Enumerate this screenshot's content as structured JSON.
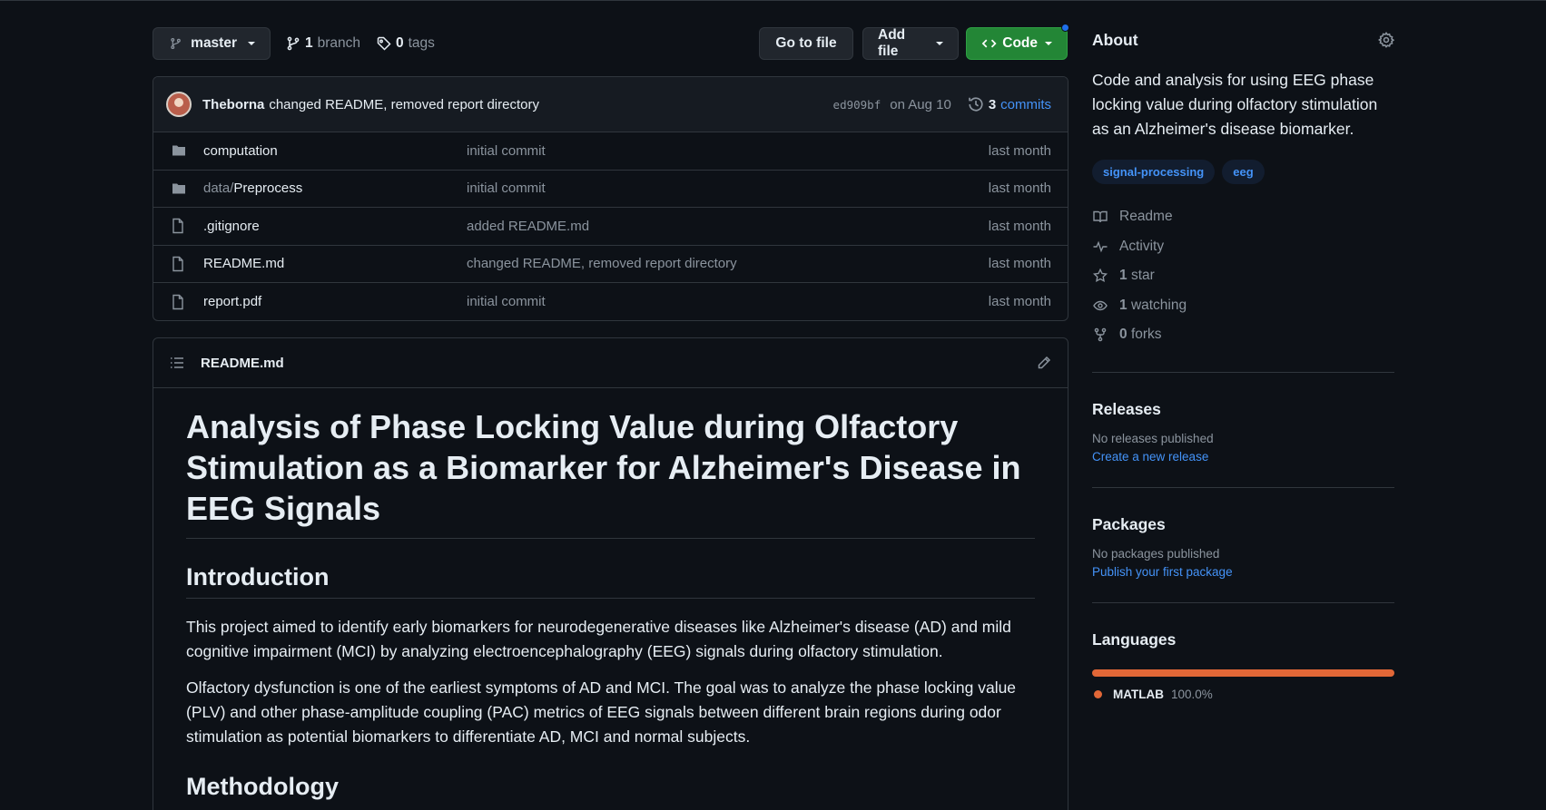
{
  "toolbar": {
    "branch_label": "master",
    "branch_count": "1",
    "branch_word": "branch",
    "tag_count": "0",
    "tag_word": "tags",
    "go_to_file": "Go to file",
    "add_file": "Add file",
    "code": "Code"
  },
  "commit": {
    "author": "Theborna",
    "message": "changed README, removed report directory",
    "sha": "ed909bf",
    "date": "on Aug 10",
    "count": "3",
    "count_word": "commits"
  },
  "files": [
    {
      "prefix": "",
      "name": "computation",
      "type": "folder",
      "commit": "initial commit",
      "age": "last month"
    },
    {
      "prefix": "data/",
      "name": "Preprocess",
      "type": "folder",
      "commit": "initial commit",
      "age": "last month"
    },
    {
      "prefix": "",
      "name": ".gitignore",
      "type": "file",
      "commit": "added README.md",
      "age": "last month"
    },
    {
      "prefix": "",
      "name": "README.md",
      "type": "file",
      "commit": "changed README, removed report directory",
      "age": "last month"
    },
    {
      "prefix": "",
      "name": "report.pdf",
      "type": "file",
      "commit": "initial commit",
      "age": "last month"
    }
  ],
  "readme": {
    "filename": "README.md",
    "title": "Analysis of Phase Locking Value during Olfactory Stimulation as a Biomarker for Alzheimer's Disease in EEG Signals",
    "h_intro": "Introduction",
    "p1": "This project aimed to identify early biomarkers for neurodegenerative diseases like Alzheimer's disease (AD) and mild cognitive impairment (MCI) by analyzing electroencephalography (EEG) signals during olfactory stimulation.",
    "p2": "Olfactory dysfunction is one of the earliest symptoms of AD and MCI. The goal was to analyze the phase locking value (PLV) and other phase-amplitude coupling (PAC) metrics of EEG signals between different brain regions during odor stimulation as potential biomarkers to differentiate AD, MCI and normal subjects.",
    "h_method": "Methodology"
  },
  "about": {
    "heading": "About",
    "description": "Code and analysis for using EEG phase locking value during olfactory stimulation as an Alzheimer's disease biomarker.",
    "topics": [
      "signal-processing",
      "eeg"
    ],
    "readme": "Readme",
    "activity": "Activity",
    "stars_count": "1",
    "stars_word": "star",
    "watching_count": "1",
    "watching_word": "watching",
    "forks_count": "0",
    "forks_word": "forks"
  },
  "releases": {
    "heading": "Releases",
    "empty": "No releases published",
    "link": "Create a new release"
  },
  "packages": {
    "heading": "Packages",
    "empty": "No packages published",
    "link": "Publish your first package"
  },
  "languages": {
    "heading": "Languages",
    "items": [
      {
        "name": "MATLAB",
        "percent": "100.0%",
        "fraction": 1.0,
        "color": "#e16737"
      }
    ]
  },
  "colors": {
    "background": "#0d1117",
    "accent_green": "#238636",
    "link_blue": "#4493f8",
    "matlab": "#e16737"
  }
}
